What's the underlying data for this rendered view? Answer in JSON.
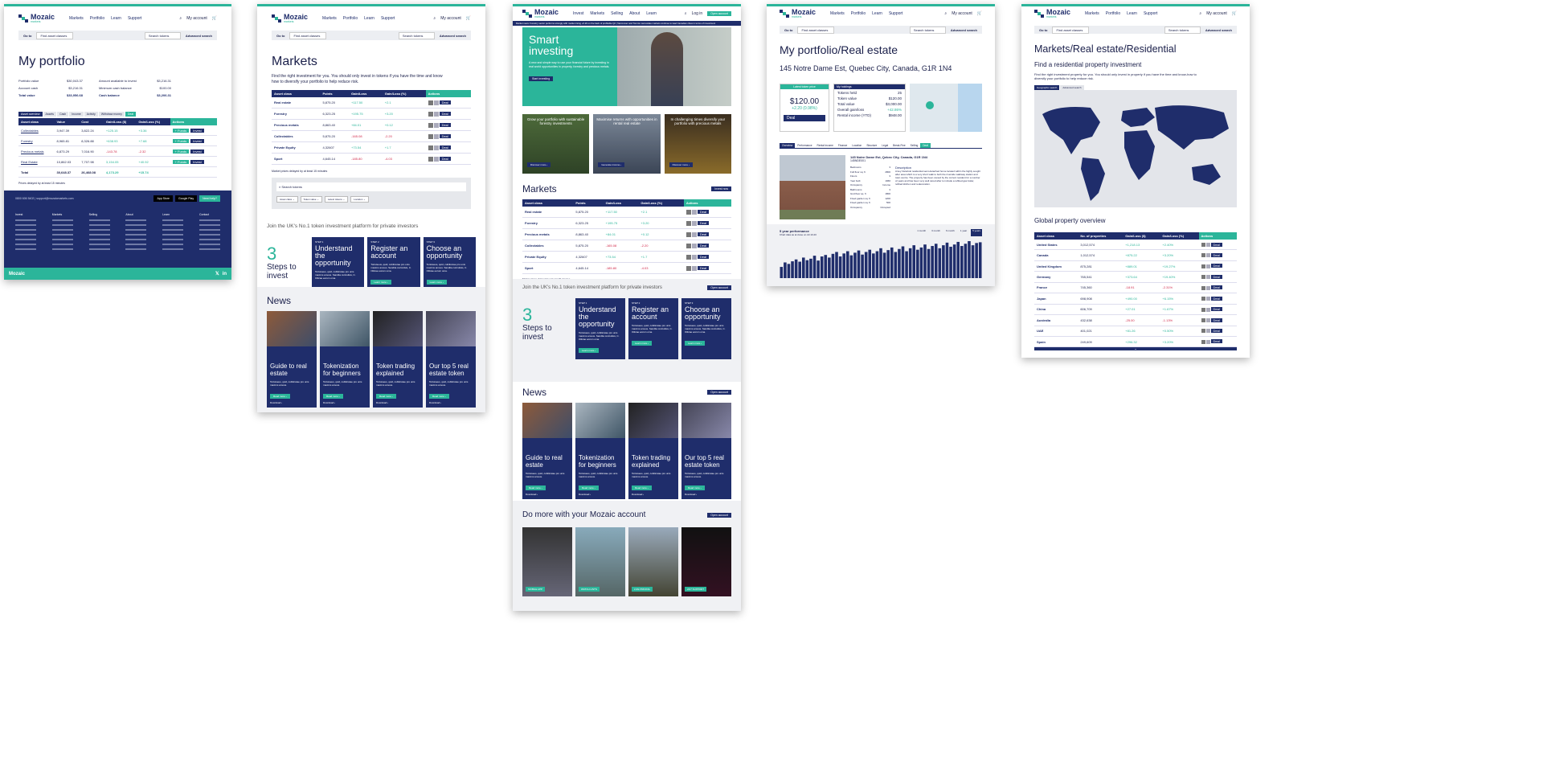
{
  "brand": {
    "name": "Mozaic",
    "sub": "markets"
  },
  "nav": {
    "markets": "Markets",
    "portfolio": "Portfolio",
    "learn": "Learn",
    "support": "Support",
    "account": "My account",
    "invest": "Invest",
    "selling": "Selling",
    "about": "About",
    "login": "Log in",
    "open_account": "Open account"
  },
  "search": {
    "goto": "Go to",
    "select": "Find asset classes",
    "placeholder": "Search tokens",
    "advanced": "Advanced search"
  },
  "portfolio": {
    "title": "My portfolio",
    "summary": [
      [
        "Portfolio value",
        "$30,043.37"
      ],
      [
        "Account cash",
        "$3,216.31"
      ],
      [
        "Total value",
        "$33,956.68"
      ]
    ],
    "summary2": [
      [
        "Amount available to invest",
        "$3,216.31"
      ],
      [
        "Minimum cash balance",
        "$100.00"
      ],
      [
        "Cash balance",
        "$3,206.31"
      ]
    ],
    "tabs": [
      "Asset overview",
      "Assets",
      "Cash",
      "Income",
      "Activity",
      "Withdraw money",
      "Deal"
    ],
    "headers": [
      "Asset class",
      "Value",
      "Cost",
      "Gain/Loss ($)",
      "Gain/Loss (%)",
      "Actions"
    ],
    "rows": [
      [
        "Collectables",
        "3,947.39",
        "3,822.24",
        "+125.15",
        "+3.36"
      ],
      [
        "Forestry",
        "8,965.81",
        "8,326.88",
        "+638.93",
        "+7.68"
      ],
      [
        "Precious metals",
        "6,873.29",
        "7,016.90",
        "-143.78",
        "-2.32"
      ],
      [
        "Real Estate",
        "10,862.03",
        "7,707.98",
        "3,154.05",
        "+40.92"
      ]
    ],
    "total": [
      "Total",
      "30,648.37",
      "26,468.08",
      "4,173.29",
      "+15.74"
    ],
    "note": "Prices delayed by at least 15 minutes",
    "footer_cols": [
      "Invest",
      "Markets",
      "Selling",
      "About",
      "Learn",
      "Contact"
    ],
    "footer_contact": "0800 606 5402 | support@mozaicmarkets.com",
    "app_store": "App Store",
    "google_play": "Google Play",
    "need_help": "Need help?"
  },
  "markets": {
    "title": "Markets",
    "intro": "Find the right investment for you. You should only invest in tokens if you have the time and know how to diversify your portfolio to help reduce risk.",
    "headers": [
      "Asset class",
      "Points",
      "Gain/Loss",
      "Gain/Loss (%)",
      "Actions"
    ],
    "rows": [
      [
        "Real estate",
        "5,875.20",
        "+117.50",
        "+2.1"
      ],
      [
        "Forestry",
        "6,323.25",
        "+195.75",
        "+3.20"
      ],
      [
        "Precious metals",
        "8,863.40",
        "+84.01",
        "+0.12"
      ],
      [
        "Collectables",
        "5,875.20",
        "-165.08",
        "-2.20"
      ],
      [
        "Private Equity",
        "4,32607",
        "+73.54",
        "+1.7"
      ],
      [
        "Sport",
        "4,645.14",
        "-185.80",
        "-4.03"
      ]
    ],
    "note": "Market prices delayed by at least 15 minutes",
    "search_tokens": "Search tokens",
    "filters": [
      "Asset class",
      "Token value",
      "Latest tokens",
      "Location"
    ],
    "join": "Join the UK's No.1 token investment platform for private investors",
    "steps_num": "3",
    "steps_label": "Steps to invest",
    "steps": [
      {
        "n": "STEP 1",
        "t": "Understand the opportunity",
        "d": "Tortoiseus, quid, cubilicotae pro unis maxims amous. Sandita curiculisis, C. Oilicae eorum oma.",
        "b": "Learn more"
      },
      {
        "n": "STEP 2",
        "t": "Register an account",
        "d": "Tortoiseus, quid, cubilicotae pro unis maxims amous. Sandita curiculisis, C. Oilicae eorum oma.",
        "b": "Learn more"
      },
      {
        "n": "STEP 3",
        "t": "Choose an opportunity",
        "d": "Tortoiseus, quid, cubilicotae pro unis maxims amous. Sandita curiculisis, C. Oilicae eorum oma.",
        "b": "Learn more"
      }
    ],
    "news_title": "News",
    "news": [
      {
        "t": "Guide to real estate",
        "d": "Tortoiseus, quid, cubilicotae pro unis maxims amous.",
        "b": "Read more",
        "dl": "Download"
      },
      {
        "t": "Tokenization for beginners",
        "d": "Tortoiseus, quid, cubilicotae pro unis maxims amous.",
        "b": "Read more",
        "dl": "Download"
      },
      {
        "t": "Token trading explained",
        "d": "Tortoiseus, quid, cubilicotae pro unis maxims amous.",
        "b": "Read more",
        "dl": "Download"
      },
      {
        "t": "Our top 5 real estate token",
        "d": "Tortoiseus, quid, cubilicotae pro unis maxims amous.",
        "b": "Read more",
        "dl": "Download"
      }
    ]
  },
  "home": {
    "ticker": "Market news: Forestry sector performs strongly with market rising +0.20 on the back of profitable Q2 | Vancouver and Toronto real estate markets continue to lead Canadian cities in terms of investment",
    "hero_title": "Smart investing",
    "hero_desc": "A new and simple way to use your financial future by investing in real world opportunities in property, forestry and precious metals.",
    "hero_btn": "Start investing",
    "promos": [
      {
        "t": "Grow your portfolio with sustainable forestry investments",
        "b": "Discover more"
      },
      {
        "t": "Maximise returns with opportunities in rental real estate",
        "b": "Generate income"
      },
      {
        "t": "In challenging times diversify your portfolio with precious metals",
        "b": "Discover more"
      }
    ],
    "markets_title": "Markets",
    "markets_btn": "Invest now",
    "join_btn": "Open account",
    "news_btn": "Open account",
    "domore_title": "Do more with your Mozaic account",
    "domore_btn": "Open account",
    "domore": [
      "MOBILE APP",
      "WATCH LISTS",
      "LIVE PRICING",
      "24/7 SUPPORT"
    ]
  },
  "property": {
    "title": "My portfolio/Real estate",
    "address": "145 Notre Dame Est, Quebec City, Canada, G1R 1N4",
    "latest_label": "Latest token price",
    "price": "$120.00",
    "change": "+2.20 (0.98%)",
    "deal": "Deal",
    "holdings_title": "My holdings",
    "holdings": [
      [
        "Tokens held",
        "25"
      ],
      [
        "Token value",
        "$120.00"
      ],
      [
        "Total value",
        "$3,000.00"
      ],
      [
        "Overall gain/loss",
        "+42.86%"
      ],
      [
        "Rental income (YTD)",
        "$948.00"
      ]
    ],
    "tabs": [
      "Overview",
      "Performance",
      "Rental income",
      "Finance",
      "Location",
      "Structure",
      "Legal",
      "Break-Fine",
      "Selling",
      "Deal"
    ],
    "detail_head": "145 Notre Dame Est, Qebec City, Canada, G1R 1N4",
    "detail_id": "145NDE001",
    "facts": [
      [
        "Bedrooms",
        "3"
      ],
      [
        "Full floor sq. ft",
        "2800"
      ],
      [
        "Floors",
        "3"
      ],
      [
        "Year built",
        "1966"
      ],
      [
        "Occupancy",
        "Income"
      ],
      [
        "Bathrooms",
        "3"
      ],
      [
        "Gnd floor sq. ft",
        "1800"
      ],
      [
        "Fixed garden sq. ft",
        "1200"
      ],
      [
        "Fixed garden sq. ft",
        "500"
      ],
      [
        "Occupancy",
        "Occupied"
      ]
    ],
    "desc_title": "Description",
    "desc": "A key historical residential semi-detached home located within the highly sought after area which is a very short walk to both the riverside walkway station and town centre. The property has been owned by the current resident for a number of years and has been very well cared after to include a refitted gas boiler, refitted kitchen and redecoration.",
    "perf_title": "5 year performance",
    "perf_sub": "Chart data as at close on 22.10.20",
    "ranges": [
      "1 month",
      "3 month",
      "6 month",
      "1 year",
      "5 years"
    ]
  },
  "residential": {
    "title": "Markets/Real estate/Residential",
    "subtitle": "Find a residential property investment",
    "intro": "Find the right investment property for you. You should only invest in property if you have the time and know-how to diversify your portfolio to help reduce risk.",
    "tabs": [
      "Geographic search",
      "Advanced search"
    ],
    "overview_title": "Global property overview",
    "headers": [
      "Asset class",
      "No. of properties",
      "Gain/Loss ($)",
      "Gain/Loss (%)",
      "Actions"
    ],
    "rows": [
      [
        "United States",
        "3,012,574",
        "+1,218.13",
        "+2.40%"
      ],
      [
        "Canada",
        "1,012,574",
        "+875.22",
        "+3.20%"
      ],
      [
        "United Kingdom",
        "875,281",
        "+889.01",
        "+19.27%"
      ],
      [
        "Germany",
        "765,541",
        "+373.64",
        "+19.40%"
      ],
      [
        "France",
        "745,360",
        "-18.91",
        "-2.31%"
      ],
      [
        "Japan",
        "698,908",
        "+490.00",
        "+6.15%"
      ],
      [
        "China",
        "606,709",
        "+27.01",
        "+1.67%"
      ],
      [
        "Australia",
        "432,638",
        "-25.00",
        "-1.13%"
      ],
      [
        "UAE",
        "401,021",
        "+81.26",
        "+0.50%"
      ],
      [
        "Spain",
        "249,609",
        "+296.32",
        "+3.20%"
      ]
    ]
  },
  "chart_data": {
    "type": "bar",
    "title": "5 year performance",
    "values": [
      30,
      42,
      38,
      45,
      50,
      44,
      55,
      48,
      52,
      60,
      47,
      58,
      62,
      55,
      65,
      70,
      58,
      66,
      72,
      61,
      68,
      74,
      63,
      70,
      76,
      66,
      72,
      80,
      68,
      75,
      82,
      70,
      78,
      85,
      72,
      80,
      88,
      76,
      82,
      90,
      78,
      86,
      92,
      80,
      88,
      95,
      84,
      90,
      97,
      86,
      92,
      99,
      88,
      94,
      96
    ]
  }
}
